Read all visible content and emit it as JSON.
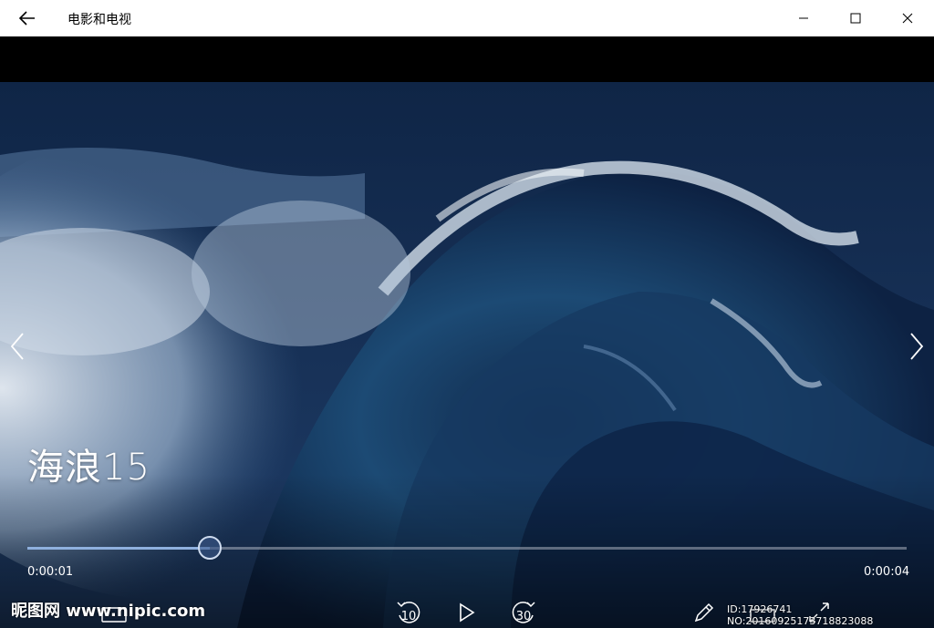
{
  "window": {
    "title": "电影和电视"
  },
  "video": {
    "title": "海浪15"
  },
  "player": {
    "current_time": "0:00:01",
    "total_time": "0:00:04",
    "progress_fraction": 0.207,
    "skip_back_seconds": "10",
    "skip_forward_seconds": "30"
  },
  "overlay": {
    "watermark_text": "昵图网 www.nipic.com",
    "watermark_id": "ID:17926741 NO:20160925173718823088"
  },
  "colors": {
    "seek_fill": "#8fb0de",
    "titlebar_bg": "#ffffff"
  }
}
